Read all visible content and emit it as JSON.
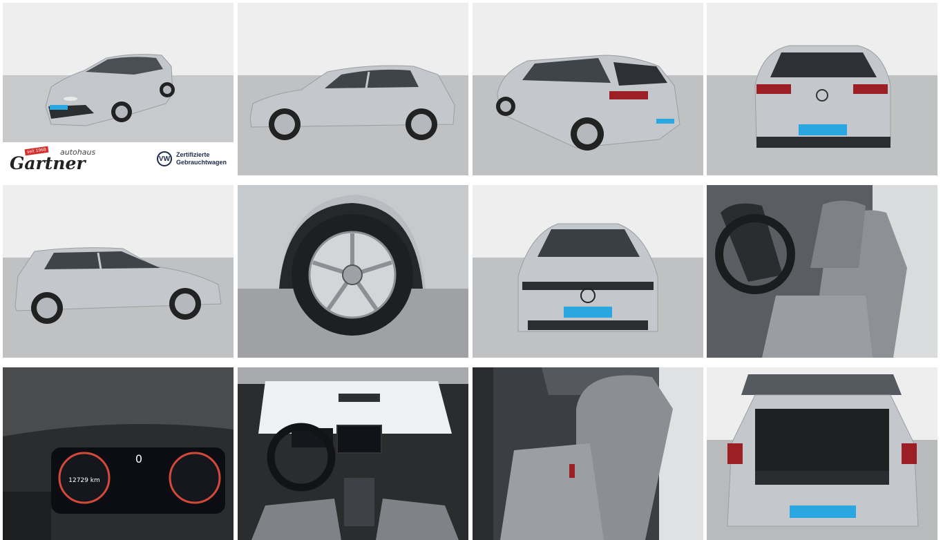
{
  "gallery": {
    "tiles": [
      {
        "name": "front-three-quarter-photo"
      },
      {
        "name": "side-profile-left-photo"
      },
      {
        "name": "rear-three-quarter-photo"
      },
      {
        "name": "rear-view-photo"
      },
      {
        "name": "side-profile-right-photo"
      },
      {
        "name": "wheel-closeup-photo"
      },
      {
        "name": "front-view-photo"
      },
      {
        "name": "front-seats-photo"
      },
      {
        "name": "instrument-cluster-photo"
      },
      {
        "name": "dashboard-photo"
      },
      {
        "name": "rear-seats-photo"
      },
      {
        "name": "trunk-photo"
      }
    ]
  },
  "dealer": {
    "since_badge": "seit 1968",
    "prefix": "autohaus",
    "name": "Gartner",
    "cert_line1": "Zertifizierte",
    "cert_line2": "Gebrauchtwagen",
    "vw_logo": "VW"
  },
  "plate_text": "Zertifizierte Gebrauchtwagen",
  "cluster": {
    "odometer": "12729 km",
    "gear": "0"
  },
  "colors": {
    "car_silver": "#c4c7cb",
    "plate_blue": "#2aa6e0",
    "interior_grey": "#8a8d91",
    "dark_trim": "#1e2022"
  }
}
